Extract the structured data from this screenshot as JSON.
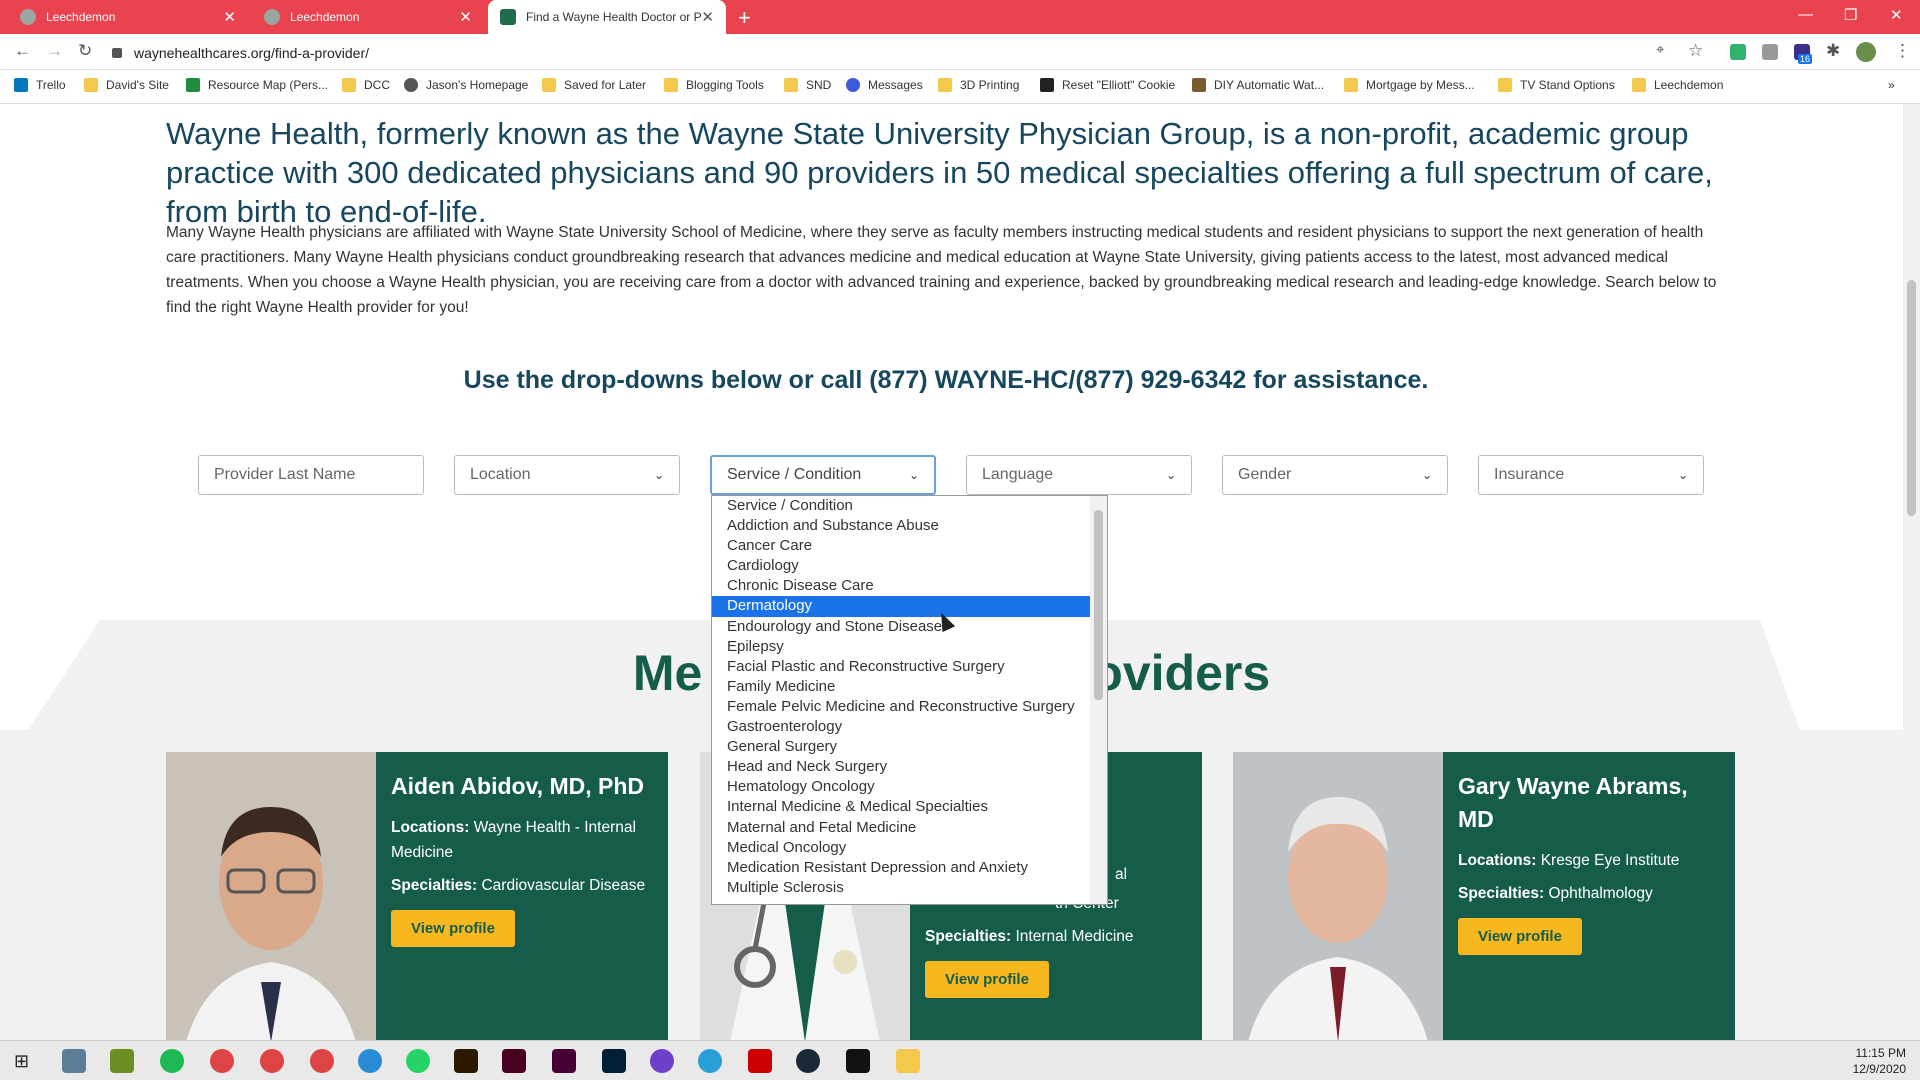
{
  "browser": {
    "tabs": [
      {
        "title": "Leechdemon"
      },
      {
        "title": "Leechdemon"
      },
      {
        "title": "Find a Wayne Health Doctor or P"
      }
    ],
    "url": "waynehealthcares.org/find-a-provider/",
    "bookmarks": [
      {
        "label": "Trello"
      },
      {
        "label": "David's Site"
      },
      {
        "label": "Resource Map (Pers..."
      },
      {
        "label": "DCC"
      },
      {
        "label": "Jason's Homepage"
      },
      {
        "label": "Saved for Later"
      },
      {
        "label": "Blogging Tools"
      },
      {
        "label": "SND"
      },
      {
        "label": "Messages"
      },
      {
        "label": "3D Printing"
      },
      {
        "label": "Reset \"Elliott\" Cookie"
      },
      {
        "label": "DIY Automatic Wat..."
      },
      {
        "label": "Mortgage by Mess..."
      },
      {
        "label": "TV Stand Options"
      },
      {
        "label": "Leechdemon"
      }
    ],
    "extension_badge": "16"
  },
  "page": {
    "lead": "Wayne Health, formerly known as the Wayne State University Physician Group, is a non-profit, academic group practice with 300 dedicated physicians and 90 providers in 50 medical specialties offering a full spectrum of care, from birth to end-of-life.",
    "body": "Many Wayne Health physicians are affiliated with Wayne State University School of Medicine, where they serve as faculty members instructing medical students and resident physicians to support the next generation of health care practitioners. Many Wayne Health physicians conduct groundbreaking research that advances medicine and medical education at Wayne State University, giving patients access to the latest, most advanced medical treatments. When you choose a Wayne Health physician, you are receiving care from a doctor with advanced training and experience, backed by groundbreaking medical research and leading-edge knowledge. Search below to find the right Wayne Health provider for you!",
    "assist": "Use the drop-downs below or call (877) WAYNE-HC/(877) 929-6342 for assistance.",
    "filters": {
      "last_name_placeholder": "Provider Last Name",
      "location": "Location",
      "service": "Service / Condition",
      "language": "Language",
      "gender": "Gender",
      "insurance": "Insurance"
    },
    "heading_left": "Me",
    "heading_right": "oviders",
    "service_options": [
      "Service / Condition",
      "Addiction and Substance Abuse",
      "Cancer Care",
      "Cardiology",
      "Chronic Disease Care",
      "Dermatology",
      "Endourology and Stone Disease",
      "Epilepsy",
      "Facial Plastic and Reconstructive Surgery",
      "Family Medicine",
      "Female Pelvic Medicine and Reconstructive Surgery",
      "Gastroenterology",
      "General Surgery",
      "Head and Neck Surgery",
      "Hematology Oncology",
      "Internal Medicine & Medical Specialties",
      "Maternal and Fetal Medicine",
      "Medical Oncology",
      "Medication Resistant Depression and Anxiety",
      "Multiple Sclerosis"
    ],
    "selected_option": "Dermatology",
    "cards": [
      {
        "name": "Aiden Abidov, MD, PhD",
        "locations_label": "Locations:",
        "locations": "Wayne Health - Internal Medicine",
        "specialties_label": "Specialties:",
        "specialties": "Cardiovascular Disease",
        "button": "View profile"
      },
      {
        "name": "",
        "locations_label": "",
        "locations": "al",
        "locations2": "th Center",
        "specialties_label": "Specialties:",
        "specialties": "Internal Medicine",
        "button": "View profile"
      },
      {
        "name": "Gary Wayne Abrams, MD",
        "locations_label": "Locations:",
        "locations": "Kresge Eye Institute",
        "specialties_label": "Specialties:",
        "specialties": "Ophthalmology",
        "button": "View profile"
      }
    ]
  },
  "taskbar": {
    "time": "11:15 PM",
    "date": "12/9/2020"
  },
  "colors": {
    "chrome_red": "#e8434f",
    "brand_green": "#155d4a",
    "button_gold": "#f7b81f",
    "selection_blue": "#1a73e8"
  }
}
